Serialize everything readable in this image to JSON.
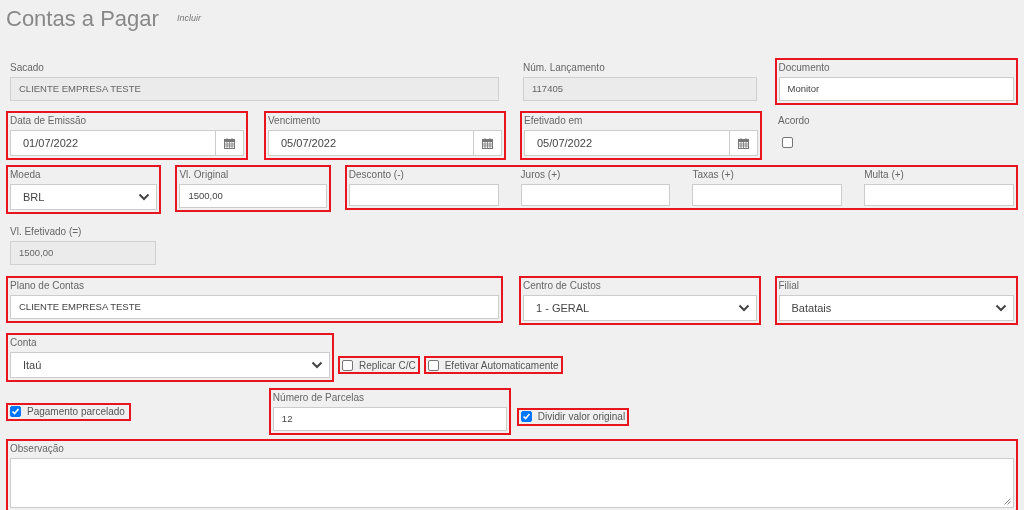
{
  "page": {
    "title": "Contas a Pagar",
    "subtitle": "Incluir"
  },
  "fields": [
    {
      "kind": "text",
      "label": "Sacado",
      "value": "CLIENTE EMPRESA TESTE",
      "readonly": true,
      "highlighted": false
    },
    {
      "kind": "text",
      "label": "Núm. Lançamento",
      "value": "117405",
      "readonly": true,
      "highlighted": false
    },
    {
      "kind": "text",
      "label": "Documento",
      "value": "Monitor",
      "readonly": false,
      "highlighted": true
    },
    {
      "kind": "date",
      "label": "Data de Emissão",
      "value": "01/07/2022",
      "highlighted": true
    },
    {
      "kind": "date",
      "label": "Vencimento",
      "value": "05/07/2022",
      "highlighted": true
    },
    {
      "kind": "date",
      "label": "Efetivado em",
      "value": "05/07/2022",
      "highlighted": true
    },
    {
      "kind": "flag",
      "label": "Acordo",
      "checked": false,
      "highlighted": false
    },
    {
      "kind": "select",
      "label": "Moeda",
      "value": "BRL",
      "highlighted": true
    },
    {
      "kind": "text",
      "label": "Vl. Original",
      "value": "1500,00",
      "readonly": false,
      "highlighted": true
    },
    {
      "kind": "group",
      "highlighted": true,
      "fields": [
        {
          "label": "Desconto (-)"
        },
        {
          "label": "Juros (+)"
        },
        {
          "label": "Taxas (+)"
        },
        {
          "label": "Multa (+)"
        }
      ]
    },
    {
      "kind": "text",
      "label": "Vl. Efetivado (=)",
      "value": "1500,00",
      "readonly": true,
      "highlighted": false
    },
    {
      "kind": "text",
      "label": "Plano de Contas",
      "value": "CLIENTE EMPRESA TESTE",
      "readonly": false,
      "highlighted": true
    },
    {
      "kind": "select",
      "label": "Centro de Custos",
      "value": "1 - GERAL",
      "highlighted": true
    },
    {
      "kind": "select",
      "label": "Filial",
      "value": "Batatais",
      "highlighted": true
    },
    {
      "kind": "select",
      "label": "Conta",
      "value": "Itaú",
      "highlighted": true
    },
    {
      "kind": "checkbox",
      "label": "Replicar C/C",
      "checked": false,
      "highlighted": true
    },
    {
      "kind": "checkbox",
      "label": "Efetivar Automaticamente",
      "checked": false,
      "highlighted": true
    },
    {
      "kind": "checkbox",
      "label": "Pagamento parcelado",
      "checked": true,
      "highlighted": true
    },
    {
      "kind": "text",
      "label": "Número de Parcelas",
      "value": "12",
      "readonly": false,
      "highlighted": true
    },
    {
      "kind": "checkbox",
      "label": "Dividir valor original",
      "checked": true,
      "highlighted": true
    },
    {
      "kind": "textarea",
      "label": "Observação",
      "highlighted": true
    }
  ]
}
